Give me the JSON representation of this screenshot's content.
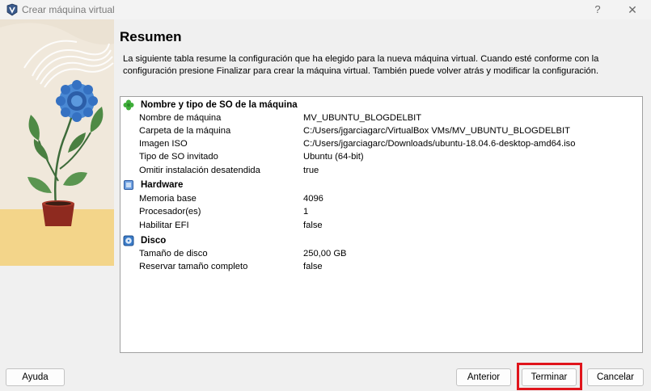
{
  "window": {
    "title": "Crear máquina virtual",
    "help_glyph": "?",
    "close_glyph": "✕"
  },
  "page": {
    "title": "Resumen",
    "description": "La siguiente tabla resume la configuración que ha elegido para la nueva máquina virtual. Cuando esté conforme con la configuración presione Finalizar para crear la máquina virtual. También puede volver atrás y modificar la configuración."
  },
  "summary": {
    "sections": [
      {
        "label": "Nombre y tipo de SO de la máquina",
        "icon": "clover-icon",
        "rows": [
          {
            "key": "Nombre de máquina",
            "value": "MV_UBUNTU_BLOGDELBIT"
          },
          {
            "key": "Carpeta de la máquina",
            "value": "C:/Users/jgarciagarc/VirtualBox VMs/MV_UBUNTU_BLOGDELBIT"
          },
          {
            "key": "Imagen ISO",
            "value": "C:/Users/jgarciagarc/Downloads/ubuntu-18.04.6-desktop-amd64.iso"
          },
          {
            "key": "Tipo de SO invitado",
            "value": "Ubuntu (64-bit)"
          },
          {
            "key": "Omitir instalación desatendida",
            "value": "true"
          }
        ]
      },
      {
        "label": "Hardware",
        "icon": "chip-icon",
        "rows": [
          {
            "key": "Memoria base",
            "value": "4096"
          },
          {
            "key": "Procesador(es)",
            "value": "1"
          },
          {
            "key": "Habilitar EFI",
            "value": "false"
          }
        ]
      },
      {
        "label": "Disco",
        "icon": "disk-icon",
        "rows": [
          {
            "key": "Tamaño de disco",
            "value": "250,00 GB"
          },
          {
            "key": "Reservar tamaño completo",
            "value": "false"
          }
        ]
      }
    ]
  },
  "buttons": {
    "help": "Ayuda",
    "back": "Anterior",
    "finish": "Terminar",
    "cancel": "Cancelar"
  },
  "colors": {
    "highlight": "#e0141b",
    "illustration_bg": "#f0e8db",
    "illustration_floor": "#f3d58a"
  }
}
